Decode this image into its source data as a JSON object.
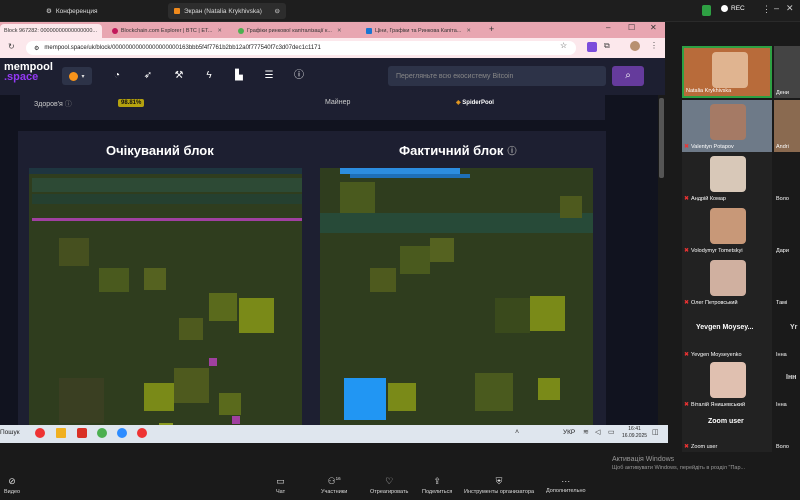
{
  "zoom_top": {
    "conference_tab": "Конференция",
    "share_tab": "Экран (Natalia Krykhivska)",
    "rec_label": "REC"
  },
  "browser": {
    "tabs": [
      {
        "label": "Block 967282: 00000000000000000..."
      },
      {
        "label": "Blockchain.com Explorer | BTC | ET..."
      },
      {
        "label": "Графіки ринкової капіталізації к..."
      },
      {
        "label": "Ціни, Графіки та Ринкова Капіта..."
      }
    ],
    "url": "mempool.space/uk/block/00000000000000000000163bbb5f4f7761b2bb12a0f777540f7c3d07dec1c1171"
  },
  "mempool": {
    "logo_top": "mempool",
    "logo_bottom": ".space",
    "search_placeholder": "Перегляньте всю екосистему Bitcoin",
    "health_label": "Здоров'я",
    "health_value": "98.81%",
    "miner_label": "Майнер",
    "miner_value": "SpiderPool",
    "expected_title": "Очікуваний блок",
    "actual_title": "Фактичний блок"
  },
  "participants": {
    "tiles": [
      {
        "name": "Natalia Krykhivska"
      },
      {
        "name": "Valentyn Potapov"
      },
      {
        "name": "Андрій Комар"
      },
      {
        "name": "Volodymyr Tometskyi"
      },
      {
        "name": "Олег Петровський"
      },
      {
        "name": "Yevgen Moyseyenko"
      },
      {
        "name": "Віталій Янишевський"
      },
      {
        "name": "Zoom user"
      }
    ],
    "edge_names": [
      "Дени",
      "Andri",
      "Воло",
      "Дари",
      "Тамі",
      "Yr",
      "Інна",
      "Iнн",
      "Воло"
    ],
    "yevgen_header": "Yevgen Moysey...",
    "zoom_header": "Zoom user"
  },
  "taskbar": {
    "search_label": "Пошук",
    "lang": "УКР",
    "time": "16:41",
    "date": "16.09.2025"
  },
  "activation": {
    "line1": "Активація Windows",
    "line2": "Щоб активувати Windows, перейдіть в розділ \"Пар..."
  },
  "zoom_bottom": {
    "video": "Видео",
    "chat": "Чат",
    "participants": "Участники",
    "participants_count": "16",
    "react": "Отреагировать",
    "share": "Поделиться",
    "host_tools": "Инструменты организатора",
    "more": "Дополнительно"
  }
}
